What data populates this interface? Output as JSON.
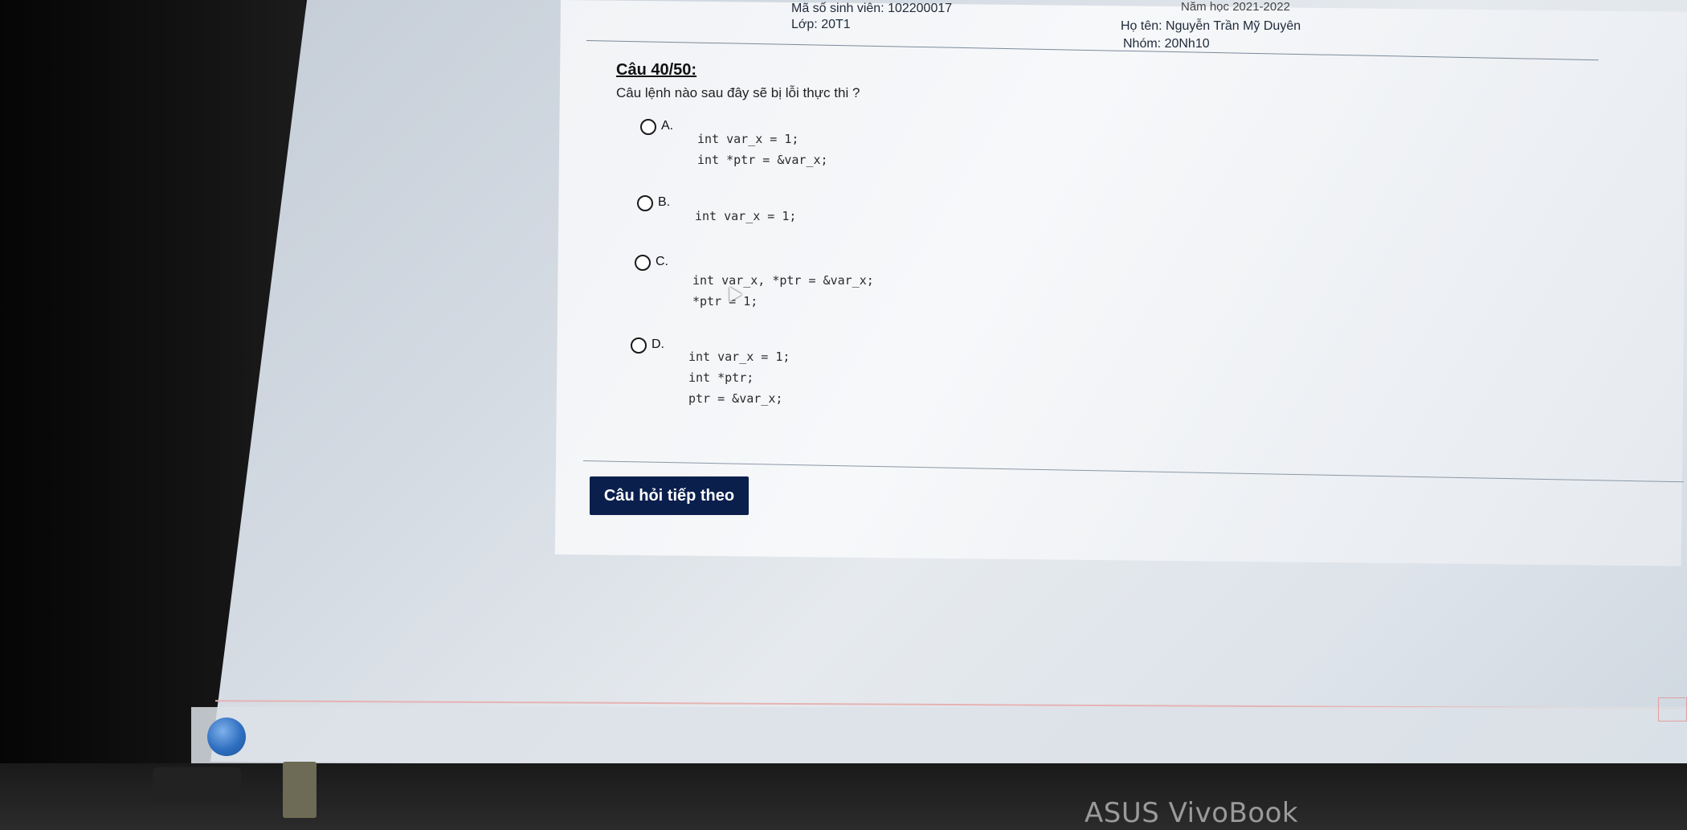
{
  "header": {
    "student_id_label": "Mã số sinh viên:",
    "student_id": "102200017",
    "class_label": "Lớp:",
    "class_value": "20T1",
    "year_text": "Năm học 2021-2022",
    "name_label": "Họ tên:",
    "name_value": "Nguyễn Trần Mỹ Duyên",
    "group_label": "Nhóm:",
    "group_value": "20Nh10"
  },
  "question": {
    "title": "Câu 40/50:",
    "text": "Câu lệnh nào sau đây sẽ bị lỗi thực thi ?"
  },
  "options": [
    {
      "letter": "A.",
      "lines": [
        "int var_x = 1;",
        "int *ptr = &var_x;"
      ]
    },
    {
      "letter": "B.",
      "lines": [
        "int var_x = 1;"
      ]
    },
    {
      "letter": "C.",
      "lines": [
        "int var_x, *ptr = &var_x;",
        "*ptr = 1;"
      ]
    },
    {
      "letter": "D.",
      "lines": [
        "int var_x = 1;",
        "int *ptr;",
        "ptr = &var_x;"
      ]
    }
  ],
  "next_button_label": "Câu hỏi tiếp theo",
  "device_brand": "ASUS VivoBook",
  "colors": {
    "button_bg": "#0b1f4d",
    "panel_bg": "#f3f5f8"
  }
}
